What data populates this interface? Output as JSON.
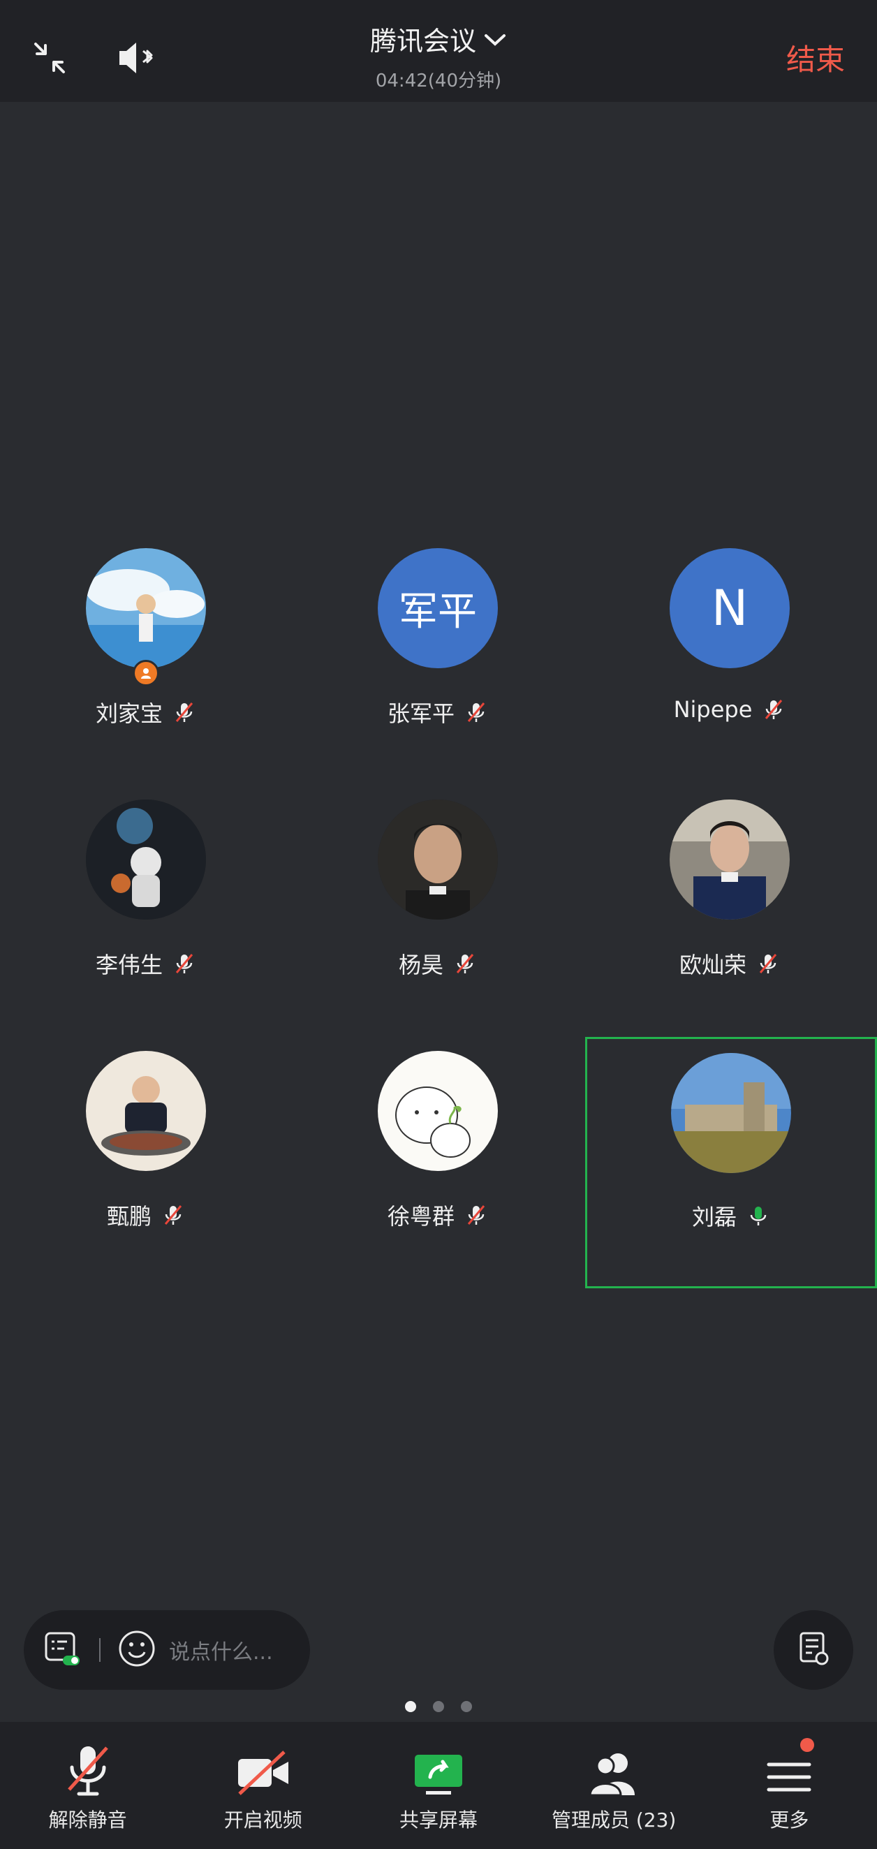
{
  "header": {
    "title": "腾讯会议",
    "subtitle": "04:42(40分钟)",
    "end_label": "结束"
  },
  "participants": [
    {
      "name": "刘家宝",
      "avatar": "photo",
      "mic": "muted",
      "host": true
    },
    {
      "name": "张军平",
      "avatar_text": "军平",
      "mic": "muted"
    },
    {
      "name": "Nipepe",
      "avatar_text": "N",
      "mic": "muted"
    },
    {
      "name": "李伟生",
      "avatar": "photo",
      "mic": "muted"
    },
    {
      "name": "杨昊",
      "avatar": "photo",
      "mic": "muted"
    },
    {
      "name": "欧灿荣",
      "avatar": "photo",
      "mic": "muted"
    },
    {
      "name": "甄鹏",
      "avatar": "photo",
      "mic": "muted"
    },
    {
      "name": "徐粤群",
      "avatar": "photo",
      "mic": "muted"
    },
    {
      "name": "刘磊",
      "avatar": "photo",
      "mic": "active",
      "speaking": true
    }
  ],
  "chat": {
    "placeholder": "说点什么..."
  },
  "pagination": {
    "pages": 3,
    "current": 1
  },
  "toolbar": {
    "unmute": "解除静音",
    "video": "开启视频",
    "share": "共享屏幕",
    "members": "管理成员 (23)",
    "more": "更多"
  },
  "colors": {
    "background": "#2a2c30",
    "bar": "#212226",
    "accent_red": "#f05a4a",
    "accent_green": "#23b34e",
    "avatar_blue": "#3f73c8"
  }
}
